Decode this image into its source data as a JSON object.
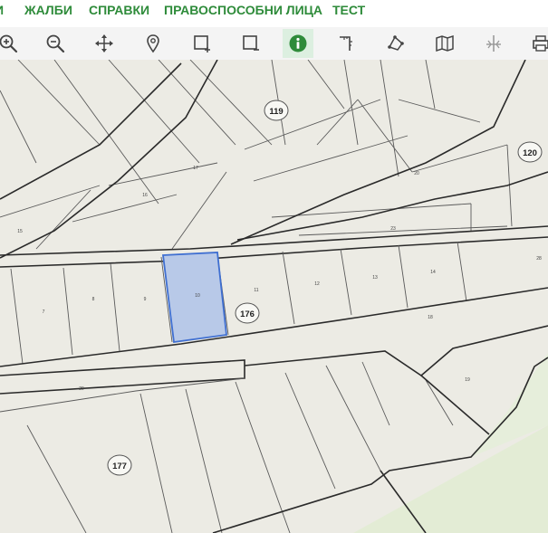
{
  "nav": {
    "items": [
      {
        "label": "И"
      },
      {
        "label": "ЖАЛБИ"
      },
      {
        "label": "СПРАВКИ"
      },
      {
        "label": "ПРАВОСПОСОБНИ ЛИЦА"
      },
      {
        "label": "ТЕСТ"
      }
    ],
    "color": "#2e8b3a"
  },
  "toolbar": {
    "tools": [
      {
        "icon": "zoom-in-icon"
      },
      {
        "icon": "zoom-out-icon"
      },
      {
        "icon": "pan-move-icon"
      },
      {
        "icon": "location-pin-icon"
      },
      {
        "icon": "select-rectangle-add-icon"
      },
      {
        "icon": "select-rectangle-remove-icon"
      },
      {
        "icon": "info-icon",
        "active": true
      },
      {
        "icon": "measure-distance-icon"
      },
      {
        "icon": "measure-area-icon"
      },
      {
        "icon": "map-layers-icon"
      },
      {
        "icon": "cross-section-icon"
      },
      {
        "icon": "print-icon"
      }
    ],
    "accent": "#2e8b3a"
  },
  "map": {
    "blocks": [
      "119",
      "120",
      "176",
      "177"
    ],
    "parcels": [
      "7",
      "8",
      "9",
      "10",
      "11",
      "12",
      "13",
      "14",
      "15",
      "16",
      "17",
      "18",
      "19",
      "20",
      "23",
      "28",
      "29"
    ],
    "selected_parcel": "10",
    "colors": {
      "background": "#ecebe4",
      "green_zone": "#e3ecd5",
      "selection_fill": "#b8c9e8",
      "selection_stroke": "#3f6fd1",
      "parcel_line": "#5a5a5a"
    }
  }
}
